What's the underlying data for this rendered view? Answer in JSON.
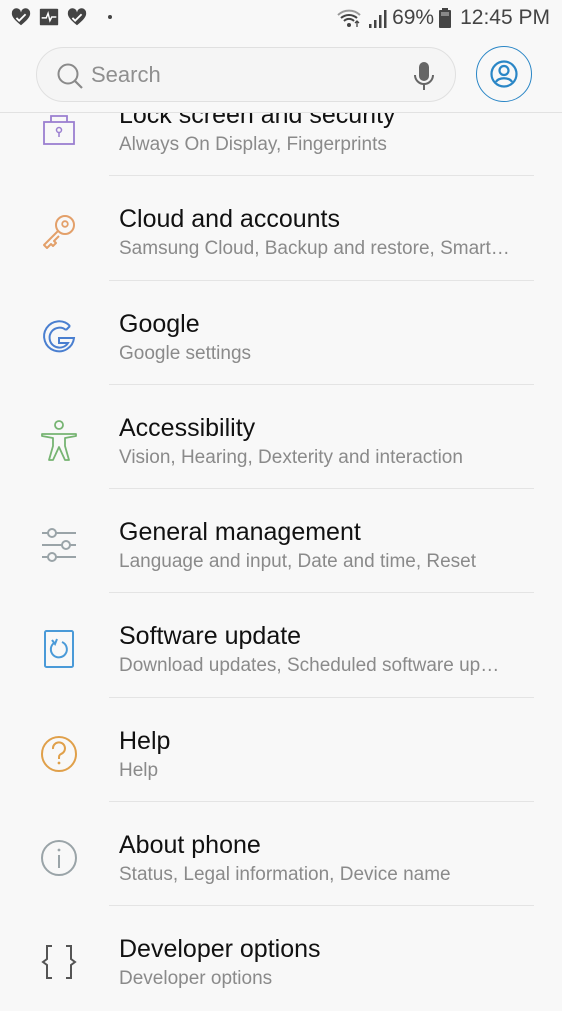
{
  "status_bar": {
    "notification_icons": [
      "health-heart-icon",
      "activity-monitor-icon",
      "health-heart-icon",
      "more-dot-icon"
    ],
    "wifi_icon": "wifi-icon",
    "signal_icon": "cellular-signal-icon",
    "battery_percent": "69%",
    "battery_icon": "battery-icon",
    "time": "12:45 PM"
  },
  "search": {
    "placeholder": "Search",
    "value": "",
    "search_icon": "search-icon",
    "mic_icon": "microphone-icon",
    "profile_icon": "account-icon"
  },
  "settings": {
    "items": [
      {
        "title": "Lock screen and security",
        "subtitle": "Always On Display, Fingerprints",
        "icon": "lock-icon",
        "color": "#9b7fd0"
      },
      {
        "title": "Cloud and accounts",
        "subtitle": "Samsung Cloud, Backup and restore, Smart…",
        "icon": "key-icon",
        "color": "#e3a06a"
      },
      {
        "title": "Google",
        "subtitle": "Google settings",
        "icon": "google-icon",
        "color": "#4a7fd0"
      },
      {
        "title": "Accessibility",
        "subtitle": "Vision, Hearing, Dexterity and interaction",
        "icon": "accessibility-icon",
        "color": "#76b472"
      },
      {
        "title": "General management",
        "subtitle": "Language and input, Date and time, Reset",
        "icon": "sliders-icon",
        "color": "#9aa4a8"
      },
      {
        "title": "Software update",
        "subtitle": "Download updates, Scheduled software up…",
        "icon": "software-update-icon",
        "color": "#4a9ad8"
      },
      {
        "title": "Help",
        "subtitle": "Help",
        "icon": "help-icon",
        "color": "#e0a04a"
      },
      {
        "title": "About phone",
        "subtitle": "Status, Legal information, Device name",
        "icon": "info-icon",
        "color": "#9aa4a8"
      },
      {
        "title": "Developer options",
        "subtitle": "Developer options",
        "icon": "braces-icon",
        "color": "#555555"
      }
    ]
  }
}
